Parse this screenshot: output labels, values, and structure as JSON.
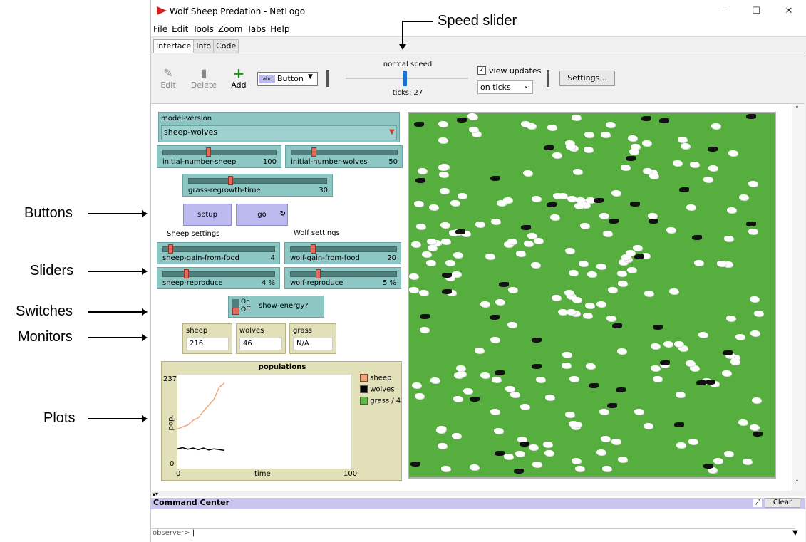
{
  "window": {
    "title": "Wolf Sheep Predation - NetLogo",
    "min": "–",
    "max": "☐",
    "close": "✕"
  },
  "menu": [
    "File",
    "Edit",
    "Tools",
    "Zoom",
    "Tabs",
    "Help"
  ],
  "tabs": [
    "Interface",
    "Info",
    "Code"
  ],
  "toolbar": {
    "edit": "Edit",
    "delete": "Delete",
    "add": "Add",
    "widget_select": "Button",
    "speed_label": "normal speed",
    "ticks": "ticks: 27",
    "view_updates": "view updates",
    "update_mode": "on ticks",
    "settings": "Settings..."
  },
  "chooser": {
    "label": "model-version",
    "value": "sheep-wolves"
  },
  "sliders": {
    "initial_sheep": {
      "label": "initial-number-sheep",
      "value": "100",
      "fraction": 0.4
    },
    "initial_wolves": {
      "label": "initial-number-wolves",
      "value": "50",
      "fraction": 0.2
    },
    "grass_regrowth": {
      "label": "grass-regrowth-time",
      "value": "30",
      "fraction": 0.3
    },
    "sheep_gain": {
      "label": "sheep-gain-from-food",
      "value": "4",
      "fraction": 0.05
    },
    "wolf_gain": {
      "label": "wolf-gain-from-food",
      "value": "20",
      "fraction": 0.2
    },
    "sheep_repro": {
      "label": "sheep-reproduce",
      "value": "4 %",
      "fraction": 0.2
    },
    "wolf_repro": {
      "label": "wolf-reproduce",
      "value": "5 %",
      "fraction": 0.25
    }
  },
  "section_labels": {
    "sheep": "Sheep settings",
    "wolf": "Wolf settings"
  },
  "buttons": {
    "setup": "setup",
    "go": "go"
  },
  "switch": {
    "label": "show-energy?",
    "on": "On",
    "off": "Off"
  },
  "monitors": [
    {
      "label": "sheep",
      "value": "216"
    },
    {
      "label": "wolves",
      "value": "46"
    },
    {
      "label": "grass",
      "value": "N/A"
    }
  ],
  "plot": {
    "title": "populations",
    "ymax": "237",
    "ymin": "0",
    "xmin": "0",
    "xmax": "100",
    "xlabel": "time",
    "ylabel": "pop.",
    "legend": [
      {
        "name": "sheep",
        "color": "#f3a57c"
      },
      {
        "name": "wolves",
        "color": "#000000"
      },
      {
        "name": "grass / 4",
        "color": "#5cb84a"
      }
    ]
  },
  "chart_data": {
    "type": "line",
    "title": "populations",
    "xlabel": "time",
    "ylabel": "pop.",
    "xlim": [
      0,
      100
    ],
    "ylim": [
      0,
      237
    ],
    "series": [
      {
        "name": "sheep",
        "color": "#f3a57c",
        "x": [
          0,
          3,
          6,
          9,
          12,
          15,
          18,
          21,
          24,
          27
        ],
        "values": [
          100,
          105,
          110,
          122,
          128,
          145,
          160,
          175,
          205,
          216
        ]
      },
      {
        "name": "wolves",
        "color": "#000000",
        "x": [
          0,
          3,
          6,
          9,
          12,
          15,
          18,
          21,
          24,
          27
        ],
        "values": [
          50,
          53,
          49,
          52,
          48,
          52,
          47,
          50,
          48,
          46
        ]
      }
    ]
  },
  "command_center": {
    "title": "Command Center",
    "clear": "Clear",
    "prompt": "observer>"
  },
  "annotations": {
    "speed": "Speed slider",
    "buttons": "Buttons",
    "sliders": "Sliders",
    "switches": "Switches",
    "monitors": "Monitors",
    "plots": "Plots"
  }
}
